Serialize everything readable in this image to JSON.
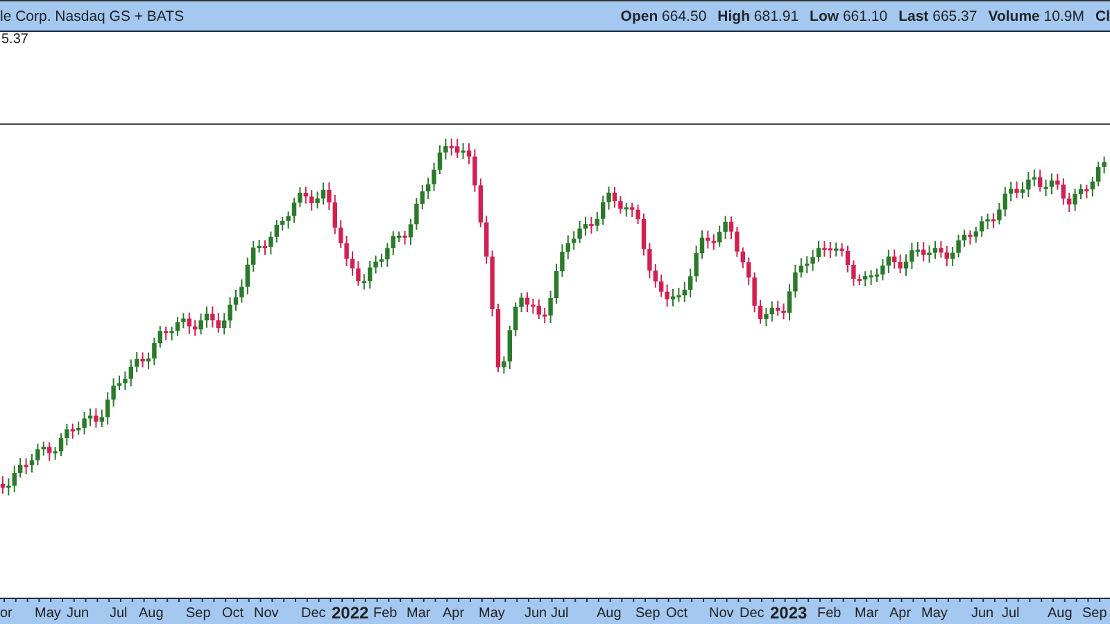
{
  "header": {
    "title": "le Corp. Nasdaq GS + BATS",
    "quote": [
      {
        "label": "Open",
        "value": "664.50"
      },
      {
        "label": "High",
        "value": "681.91"
      },
      {
        "label": "Low",
        "value": "661.10"
      },
      {
        "label": "Last",
        "value": "665.37"
      },
      {
        "label": "Volume",
        "value": "10.9M"
      },
      {
        "label": "Cl"
      }
    ]
  },
  "last_price_label": "5.37",
  "x_axis": [
    {
      "label": "or",
      "kind": "month"
    },
    {
      "label": "May",
      "kind": "month"
    },
    {
      "label": "Jun",
      "kind": "month"
    },
    {
      "label": "Jul",
      "kind": "month"
    },
    {
      "label": "Aug",
      "kind": "month"
    },
    {
      "label": "Sep",
      "kind": "month"
    },
    {
      "label": "Oct",
      "kind": "month"
    },
    {
      "label": "Nov",
      "kind": "month"
    },
    {
      "label": "Dec",
      "kind": "month"
    },
    {
      "label": "2022",
      "kind": "year"
    },
    {
      "label": "Feb",
      "kind": "month"
    },
    {
      "label": "Mar",
      "kind": "month"
    },
    {
      "label": "Apr",
      "kind": "month"
    },
    {
      "label": "May",
      "kind": "month"
    },
    {
      "label": "Jun",
      "kind": "month"
    },
    {
      "label": "Jul",
      "kind": "month"
    },
    {
      "label": "Aug",
      "kind": "month"
    },
    {
      "label": "Sep",
      "kind": "month"
    },
    {
      "label": "Oct",
      "kind": "month"
    },
    {
      "label": "Nov",
      "kind": "month"
    },
    {
      "label": "Dec",
      "kind": "month"
    },
    {
      "label": "2023",
      "kind": "year"
    },
    {
      "label": "Feb",
      "kind": "month"
    },
    {
      "label": "Mar",
      "kind": "month"
    },
    {
      "label": "Apr",
      "kind": "month"
    },
    {
      "label": "May",
      "kind": "month"
    },
    {
      "label": "Jun",
      "kind": "month"
    },
    {
      "label": "Jul",
      "kind": "month"
    },
    {
      "label": "Aug",
      "kind": "month"
    },
    {
      "label": "Sep",
      "kind": "month"
    }
  ]
}
